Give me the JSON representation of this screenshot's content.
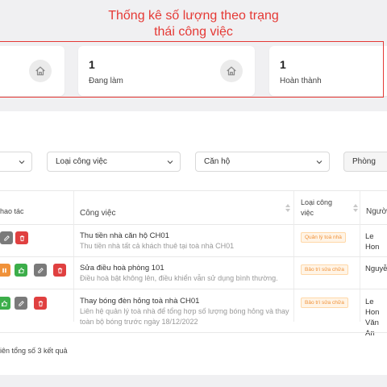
{
  "annotation": {
    "line1": "Thống kê số lượng theo trạng",
    "line2": "thái công việc"
  },
  "stats": [
    {
      "count": "1",
      "label": "Đang làm"
    },
    {
      "count": "1",
      "label": "Hoàn thành"
    }
  ],
  "filters": {
    "task_type": "Loại công việc",
    "apartment": "Căn hộ",
    "room": "Phòng"
  },
  "table": {
    "headers": {
      "actions": "hao tác",
      "task": "Công việc",
      "type": "Loại công việc",
      "person": "Người"
    },
    "rows": [
      {
        "title": "Thu tiền nhà căn hộ CH01",
        "desc": "Thu tiền nhà tất cả khách thuê tại toà nhà CH01",
        "type": "Quản lý toà nhà",
        "person": "Le Hon"
      },
      {
        "title": "Sửa điều hoà phòng 101",
        "desc": "Điều hoà bật không lên, điều khiển vẫn sử dụng bình thường.",
        "type": "Bảo trì sửa chữa",
        "person": "Nguyễ"
      },
      {
        "title": "Thay bóng đèn hỏng toà nhà CH01",
        "desc": "Liên hệ quản lý toà nhà để tổng hợp số lượng bóng hỏng và thay toàn bộ bóng trước ngày 18/12/2022",
        "type": "Bảo trì sửa chữa",
        "person": "Le Hon",
        "person2": "Văn An"
      }
    ]
  },
  "footer": "iên tổng số 3 kết quả",
  "colors": {
    "accent_red": "#e53935",
    "tag_orange": "#f0923a"
  }
}
